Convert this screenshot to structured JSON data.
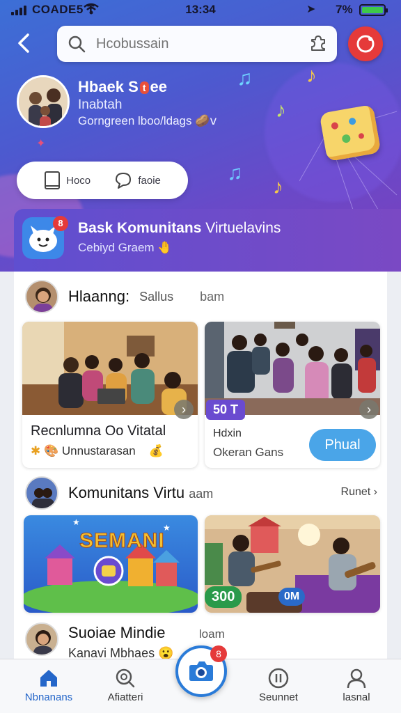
{
  "status_bar": {
    "carrier": "COADE5 T",
    "time": "13:34",
    "battery": "7%"
  },
  "header": {
    "search_placeholder": "Hcobussain"
  },
  "profile": {
    "name_a": "Hbaek S",
    "name_tag": "t",
    "name_b": "ee",
    "subtitle": "Inabtah",
    "detail": "Gorngreen lboo/ldags",
    "detail_emoji": "🥔ⅴ"
  },
  "actions": {
    "home_label": "Hoco",
    "comment_label": "faoie"
  },
  "community": {
    "title": "Bask Komunitans",
    "title_rest": "Virtuelavins",
    "subtitle": "Cebiyd Graem",
    "badge": "8"
  },
  "section1": {
    "title": "Hlaanng:",
    "status": "Sallus",
    "extra": "bam"
  },
  "card1": {
    "title": "Recnlumna Oo Vitatal",
    "sub": "Unnustarasan",
    "emoji": "💰"
  },
  "card2": {
    "badge": "50 T",
    "line1": "Hdxin",
    "line2": "Okeran Gans",
    "button": "Phual"
  },
  "section2": {
    "title": "Komunitans Virtu",
    "title_rest": "aam",
    "see_all": "Runet"
  },
  "card3": {
    "title": "SEMANI"
  },
  "card4": {
    "badge_green": "300",
    "badge_blue": "0M"
  },
  "section3": {
    "title": "Suoiae Mindie",
    "extra": "loam",
    "sub": "Kanavi Mbhaes",
    "emoji": "😮"
  },
  "bottom_nav": {
    "home": "Nbnanans",
    "explore": "Afiatteri",
    "center_badge": "8",
    "moment": "Seunnet",
    "profile": "lasnal"
  },
  "colors": {
    "accent": "#2466c9",
    "badge_red": "#e53a3a",
    "pill_blue": "#4aa5e8"
  }
}
